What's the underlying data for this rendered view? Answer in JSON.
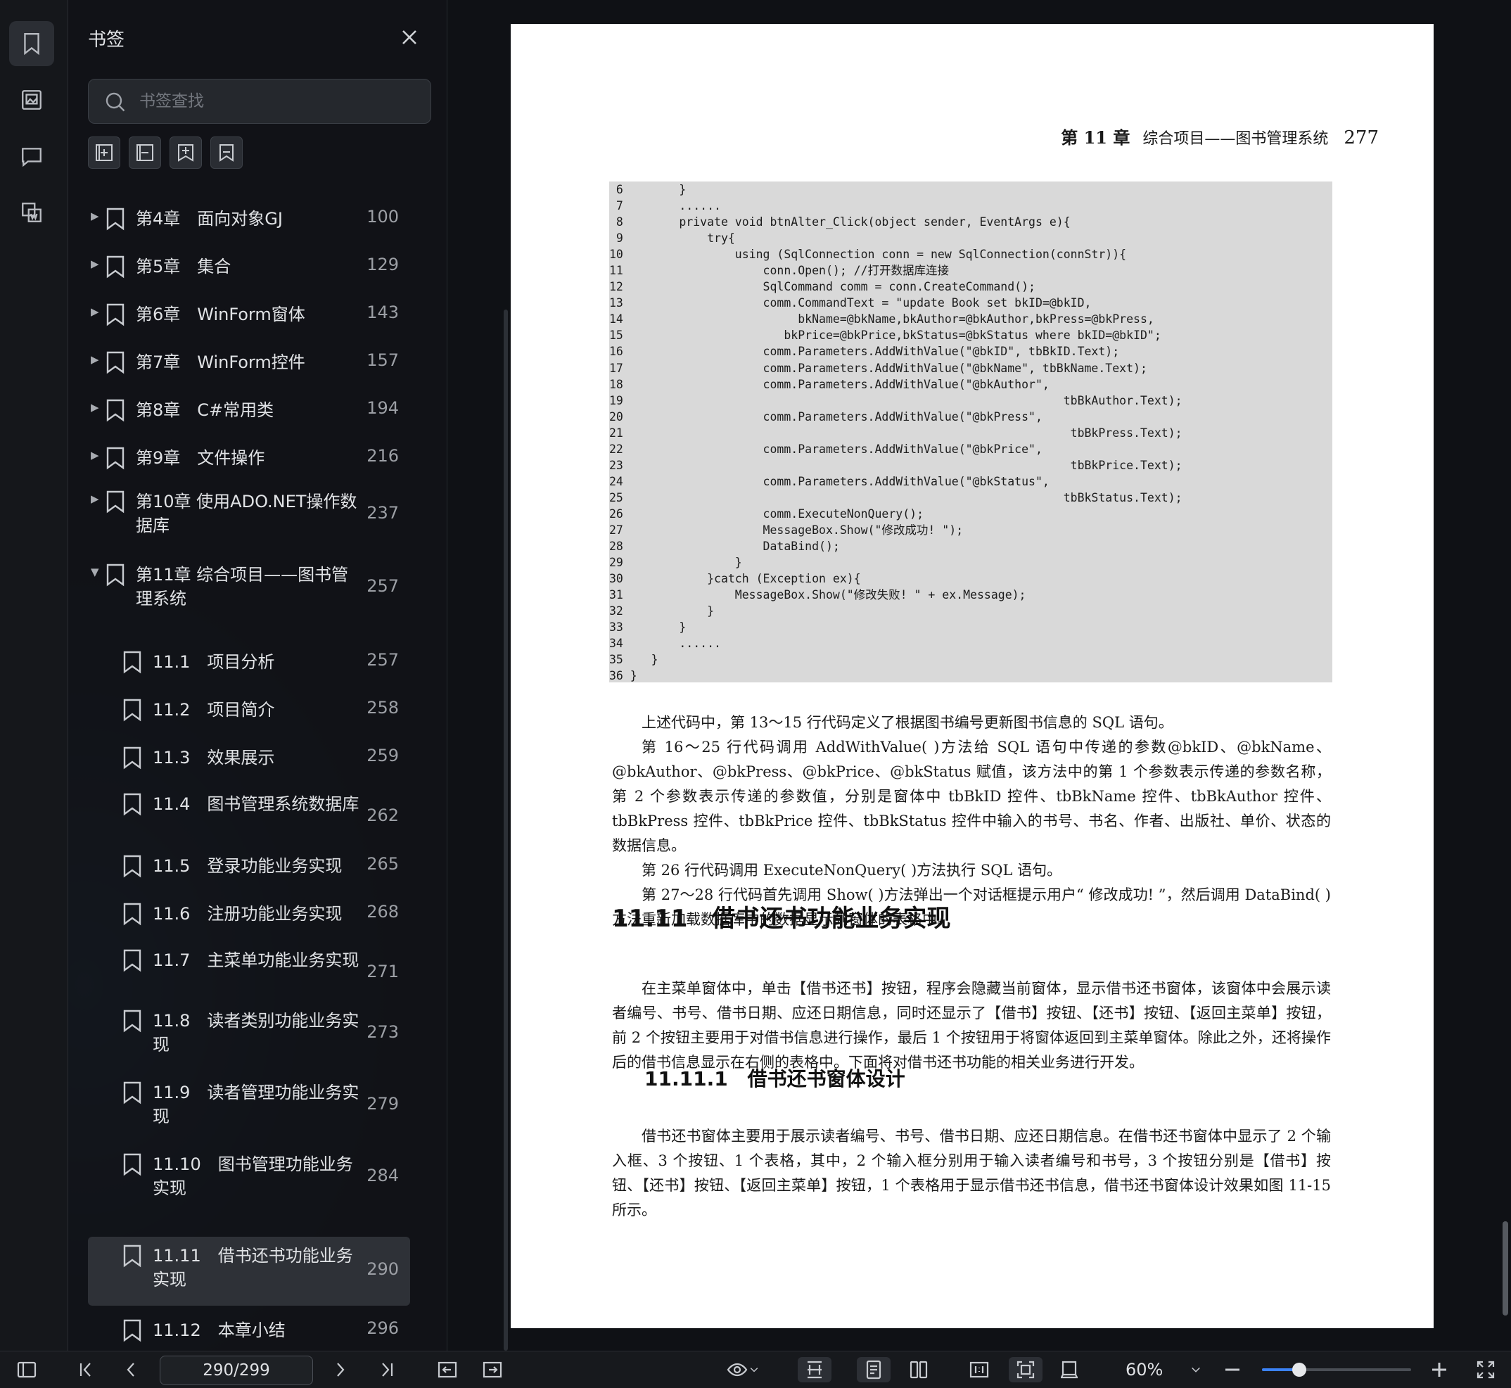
{
  "sidebar": {
    "title": "书签",
    "search_placeholder": "书签查找",
    "items": [
      {
        "label": "第4章　面向对象GJ",
        "page": "100",
        "level": 0,
        "expanded": false
      },
      {
        "label": "第5章　集合",
        "page": "129",
        "level": 0,
        "expanded": false
      },
      {
        "label": "第6章　WinForm窗体",
        "page": "143",
        "level": 0,
        "expanded": false
      },
      {
        "label": "第7章　WinForm控件",
        "page": "157",
        "level": 0,
        "expanded": false
      },
      {
        "label": "第8章　C#常用类",
        "page": "194",
        "level": 0,
        "expanded": false
      },
      {
        "label": "第9章　文件操作",
        "page": "216",
        "level": 0,
        "expanded": false
      },
      {
        "label": "第10章 使用ADO.NET操作数据库",
        "page": "237",
        "level": 0,
        "expanded": false
      },
      {
        "label": "第11章 综合项目——图书管理系统",
        "page": "257",
        "level": 0,
        "expanded": true
      },
      {
        "label": "11.1　项目分析",
        "page": "257",
        "level": 1
      },
      {
        "label": "11.2　项目简介",
        "page": "258",
        "level": 1
      },
      {
        "label": "11.3　效果展示",
        "page": "259",
        "level": 1
      },
      {
        "label": "11.4　图书管理系统数据库",
        "page": "262",
        "level": 1
      },
      {
        "label": "11.5　登录功能业务实现",
        "page": "265",
        "level": 1
      },
      {
        "label": "11.6　注册功能业务实现",
        "page": "268",
        "level": 1
      },
      {
        "label": "11.7　主菜单功能业务实现",
        "page": "271",
        "level": 1
      },
      {
        "label": "11.8　读者类别功能业务实现",
        "page": "273",
        "level": 1
      },
      {
        "label": "11.9　读者管理功能业务实现",
        "page": "279",
        "level": 1
      },
      {
        "label": "11.10　图书管理功能业务实现",
        "page": "284",
        "level": 1
      },
      {
        "label": "11.11　借书还书功能业务实现",
        "page": "290",
        "level": 1,
        "selected": true
      },
      {
        "label": "11.12　本章小结",
        "page": "296",
        "level": 1
      }
    ]
  },
  "document": {
    "running_head": {
      "chapter": "第 11 章",
      "title": "综合项目——图书管理系统",
      "page": "277"
    },
    "code_lines": [
      " 6        }",
      " 7        ......",
      " 8        private void btnAlter_Click(object sender, EventArgs e){",
      " 9            try{",
      "10                using (SqlConnection conn = new SqlConnection(connStr)){",
      "11                    conn.Open(); //打开数据库连接",
      "12                    SqlCommand comm = conn.CreateCommand();",
      "13                    comm.CommandText = \"update Book set bkID=@bkID,",
      "14                         bkName=@bkName,bkAuthor=@bkAuthor,bkPress=@bkPress,",
      "15                       bkPrice=@bkPrice,bkStatus=@bkStatus where bkID=@bkID\";",
      "16                    comm.Parameters.AddWithValue(\"@bkID\", tbBkID.Text);",
      "17                    comm.Parameters.AddWithValue(\"@bkName\", tbBkName.Text);",
      "18                    comm.Parameters.AddWithValue(\"@bkAuthor\",",
      "19                                                               tbBkAuthor.Text);",
      "20                    comm.Parameters.AddWithValue(\"@bkPress\",",
      "21                                                                tbBkPress.Text);",
      "22                    comm.Parameters.AddWithValue(\"@bkPrice\",",
      "23                                                                tbBkPrice.Text);",
      "24                    comm.Parameters.AddWithValue(\"@bkStatus\",",
      "25                                                               tbBkStatus.Text);",
      "26                    comm.ExecuteNonQuery();",
      "27                    MessageBox.Show(\"修改成功! \");",
      "28                    DataBind();",
      "29                }",
      "30            }catch (Exception ex){",
      "31                MessageBox.Show(\"修改失败! \" + ex.Message);",
      "32            }",
      "33        }",
      "34        ......",
      "35    }",
      "36 }"
    ],
    "para1": [
      "上述代码中，第 13～15 行代码定义了根据图书编号更新图书信息的 SQL 语句。",
      "第 16～25 行代码调用 AddWithValue( )方法给 SQL 语句中传递的参数@bkID、@bkName、@bkAuthor、@bkPress、@bkPrice、@bkStatus 赋值，该方法中的第 1 个参数表示传递的参数名称，第 2 个参数表示传递的参数值，分别是窗体中 tbBkID 控件、tbBkName 控件、tbBkAuthor 控件、tbBkPress 控件、tbBkPrice 控件、tbBkStatus 控件中输入的书号、书名、作者、出版社、单价、状态的数据信息。",
      "第 26 行代码调用 ExecuteNonQuery( )方法执行 SQL 语句。",
      "第 27～28 行代码首先调用 Show( )方法弹出一个对话框提示用户“ 修改成功! ”，然后调用 DataBind( )方法重新加载数据库中的数据显示到窗体的表格中。"
    ],
    "heading2": "11.11　借书还书功能业务实现",
    "para2": "在主菜单窗体中，单击【借书还书】按钮，程序会隐藏当前窗体，显示借书还书窗体，该窗体中会展示读者编号、书号、借书日期、应还日期信息，同时还显示了【借书】按钮、【还书】按钮、【返回主菜单】按钮，前 2 个按钮主要用于对借书信息进行操作，最后 1 个按钮用于将窗体返回到主菜单窗体。除此之外，还将操作后的借书信息显示在右侧的表格中。下面将对借书还书功能的相关业务进行开发。",
    "heading3": "11.11.1　借书还书窗体设计",
    "para3": "借书还书窗体主要用于展示读者编号、书号、借书日期、应还日期信息。在借书还书窗体中显示了 2 个输入框、3 个按钮、1 个表格，其中，2 个输入框分别用于输入读者编号和书号，3 个按钮分别是【借书】按钮、【还书】按钮、【返回主菜单】按钮，1 个表格用于显示借书还书信息，借书还书窗体设计效果如图 11-15 所示。"
  },
  "toolbar": {
    "page_indicator": "290/299",
    "zoom": "60%",
    "zoom_fraction": 0.25,
    "accent_color": "#3b82f6"
  },
  "icons": [
    "bookmark-icon",
    "image-icon",
    "comment-icon",
    "attachment-icon",
    "close-icon",
    "search-icon",
    "add-bookmark-icon",
    "collapse-icon",
    "expand-icon",
    "bookmark-outline-icon",
    "sidebar-toggle-icon",
    "first-page-icon",
    "prev-page-icon",
    "next-page-icon",
    "last-page-icon",
    "back-icon",
    "forward-icon",
    "eye-icon",
    "chevron-down-icon",
    "fit-width-icon",
    "single-page-icon",
    "double-page-icon",
    "actual-size-icon",
    "fit-page-icon",
    "crop-icon",
    "zoom-out-icon",
    "zoom-in-icon",
    "fullscreen-icon"
  ]
}
